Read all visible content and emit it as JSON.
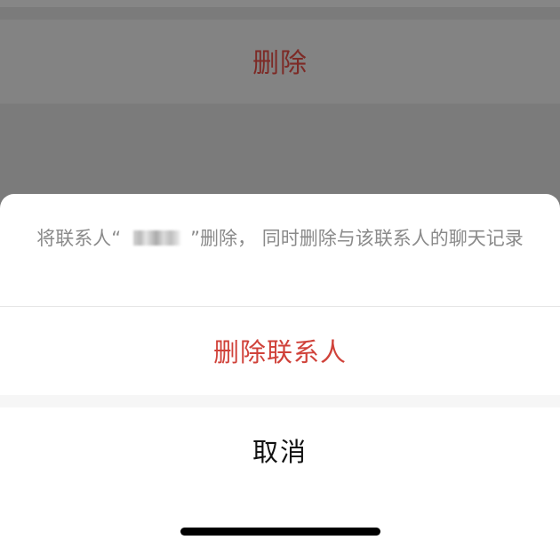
{
  "background": {
    "delete_label": "删除"
  },
  "sheet": {
    "message_prefix": "将联系人",
    "message_open_quote": "“",
    "message_close_quote": "”",
    "message_suffix": "删除， 同时删除与该联系人的聊天记录",
    "confirm_label": "删除联系人",
    "cancel_label": "取消"
  },
  "colors": {
    "destructive": "#d0423a",
    "message_text": "#8a8a8a",
    "cancel_text": "#111111",
    "overlay": "#7b7b7b"
  }
}
